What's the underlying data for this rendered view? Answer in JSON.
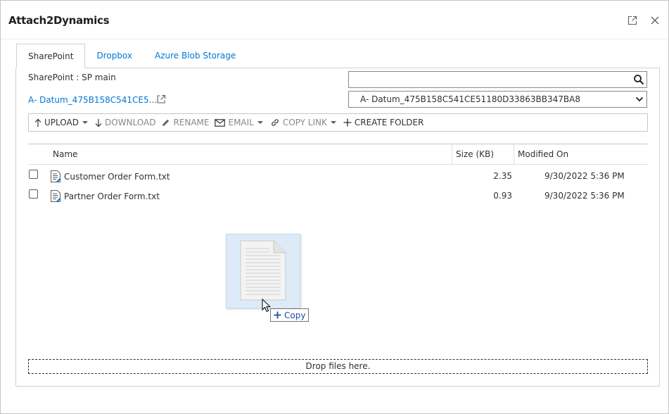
{
  "window": {
    "title": "Attach2Dynamics"
  },
  "tabs": [
    {
      "label": "SharePoint",
      "active": true
    },
    {
      "label": "Dropbox",
      "active": false
    },
    {
      "label": "Azure Blob Storage",
      "active": false
    }
  ],
  "sharepoint": {
    "site_label": "SharePoint : SP main",
    "library_link": "A- Datum_475B158C541CE5...",
    "search": {
      "value": "",
      "placeholder": ""
    },
    "library_select": "A- Datum_475B158C541CE51180D33863BB347BA8"
  },
  "toolbar": {
    "upload": "UPLOAD",
    "download": "DOWNLOAD",
    "rename": "RENAME",
    "email": "EMAIL",
    "copy_link": "COPY LINK",
    "create_folder": "CREATE FOLDER"
  },
  "grid": {
    "columns": {
      "name": "Name",
      "size": "Size (KB)",
      "modified": "Modified On"
    },
    "rows": [
      {
        "name": "Customer Order Form.txt",
        "size": "2.35",
        "modified": "9/30/2022 5:36 PM"
      },
      {
        "name": "Partner Order Form.txt",
        "size": "0.93",
        "modified": "9/30/2022 5:36 PM"
      }
    ]
  },
  "drag": {
    "copy_label": "Copy"
  },
  "dropzone": {
    "label": "Drop files here."
  },
  "colors": {
    "accent": "#0078d4",
    "border": "#d2d0ce",
    "drag_fill": "#dcebf7"
  }
}
